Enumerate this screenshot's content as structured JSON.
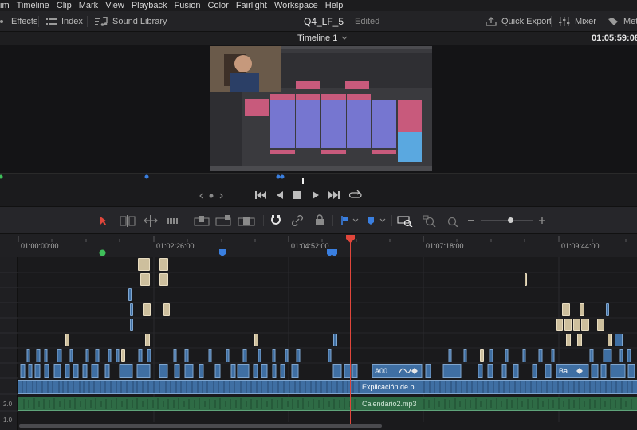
{
  "menu": {
    "items": [
      "im",
      "Timeline",
      "Clip",
      "Mark",
      "View",
      "Playback",
      "Fusion",
      "Color",
      "Fairlight",
      "Workspace",
      "Help"
    ]
  },
  "toolbar": {
    "effects_label": "Effects",
    "index_label": "Index",
    "sound_library_label": "Sound Library",
    "project_name": "Q4_LF_5",
    "project_status": "Edited",
    "quick_export_label": "Quick Export",
    "mixer_label": "Mixer",
    "meta_label": "Met"
  },
  "viewer": {
    "timeline_name": "Timeline 1",
    "timecode": "01:05:59:08"
  },
  "ruler": {
    "timecodes": [
      "01:00:00:00",
      "01:02:26:00",
      "01:04:52:00",
      "01:07:18:00",
      "01:09:44:00"
    ]
  },
  "track_headers": {
    "a1_level": "2.0",
    "a2_level": "1.0"
  },
  "clips": {
    "video_clip_a": "A00...",
    "video_clip_b": "Ba...",
    "main_video_clip": "Explicación de bl...",
    "audio_clip": "Calendario2.mp3"
  },
  "colors": {
    "playhead": "#e0463b",
    "video_clip": "#3f6fa3",
    "audio_clip": "#2e6b45",
    "marker_blue": "#3a7fe0",
    "marker_green": "#3fbf5a"
  }
}
